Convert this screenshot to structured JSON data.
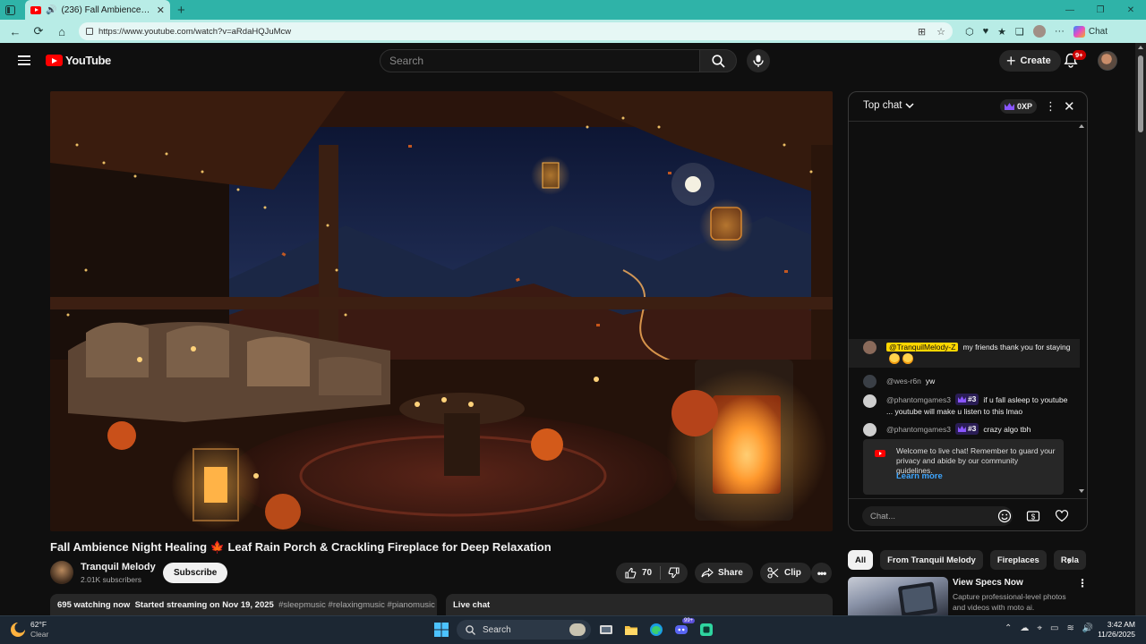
{
  "browser": {
    "tab_title": "(236) Fall Ambience Night H...",
    "url": "https://www.youtube.com/watch?v=aRdaHQJuMcw",
    "chat_label": "Chat"
  },
  "masthead": {
    "logo_text": "YouTube",
    "search_placeholder": "Search",
    "create_label": "Create",
    "notification_badge": "9+"
  },
  "video": {
    "title": "Fall Ambience Night Healing 🍁 Leaf Rain Porch & Crackling Fireplace for Deep Relaxation",
    "channel_name": "Tranquil Melody",
    "subscribers": "2.01K subscribers",
    "subscribe_label": "Subscribe",
    "likes": "70",
    "share_label": "Share",
    "clip_label": "Clip",
    "more_label": "•••",
    "watching": "695 watching now",
    "started": "Started streaming on Nov 19, 2025",
    "tags": "#sleepmusic #relaxingmusic #pianomusic",
    "live_chat_label": "Live chat"
  },
  "chat": {
    "mode_label": "Top chat",
    "xp_label": "0XP",
    "messages": [
      {
        "author": "@TranquilMelody-Z",
        "text": "my friends thank you for staying",
        "owner": true
      },
      {
        "author": "@wes-r6n",
        "text": "yw"
      },
      {
        "author": "@phantomgames3",
        "rank": "#3",
        "text": "if u fall asleep to youtube ... youtube will make u listen to this lmao"
      },
      {
        "author": "@phantomgames3",
        "rank": "#3",
        "text": "crazy algo tbh"
      }
    ],
    "welcome_text": "Welcome to live chat! Remember to guard your privacy and abide by our community guidelines.",
    "learn_more": "Learn more",
    "input_placeholder": "Chat..."
  },
  "related": {
    "chips": [
      "All",
      "From Tranquil Melody",
      "Fireplaces",
      "Rela"
    ],
    "ad_title": "View Specs Now",
    "ad_desc": "Capture professional-level photos and videos with moto ai."
  },
  "taskbar": {
    "temp": "62°F",
    "condition": "Clear",
    "search_label": "Search",
    "time": "3:42 AM",
    "date": "11/26/2025",
    "edge_badge": "99+"
  }
}
